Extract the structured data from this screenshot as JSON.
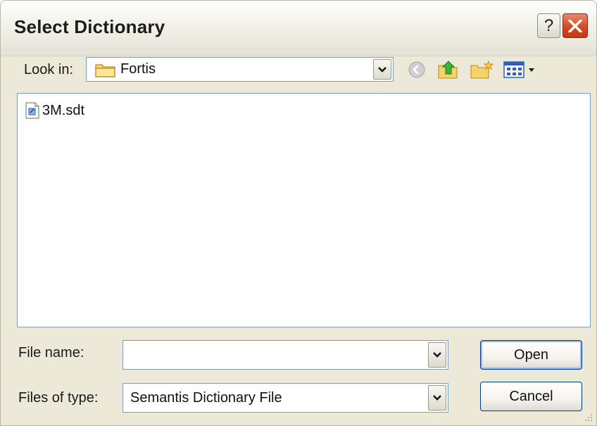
{
  "window": {
    "title": "Select Dictionary",
    "help_label": "?"
  },
  "lookin": {
    "label": "Look in:",
    "value": "Fortis"
  },
  "files": [
    {
      "name": "3M.sdt"
    }
  ],
  "filename": {
    "label": "File name:",
    "value": ""
  },
  "filetype": {
    "label": "Files of type:",
    "value": "Semantis Dictionary File"
  },
  "buttons": {
    "open": "Open",
    "cancel": "Cancel"
  },
  "colors": {
    "accent": "#0a246a",
    "close": "#d44a24",
    "folder": "#f5d36b"
  }
}
